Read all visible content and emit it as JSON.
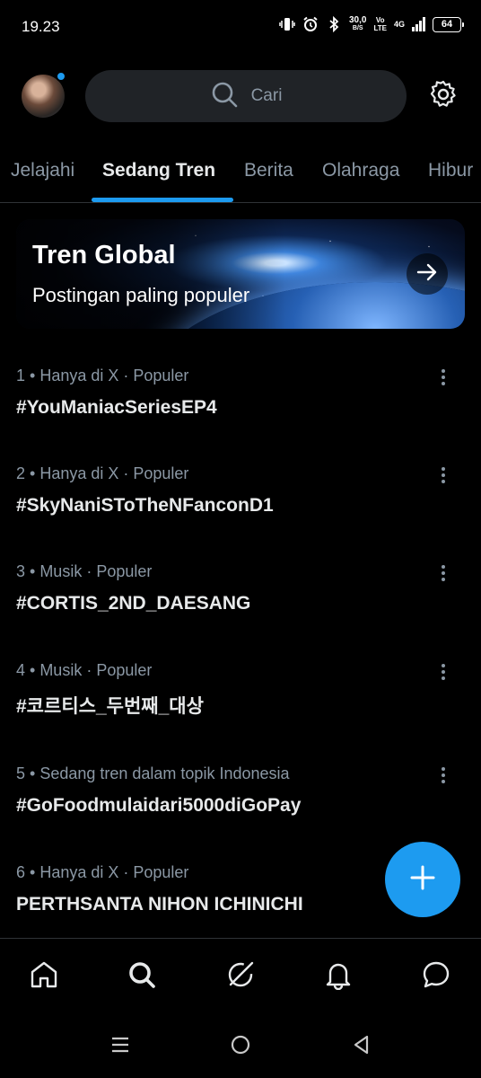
{
  "status_bar": {
    "time": "19.23",
    "speed_value": "30,0",
    "speed_unit": "B/S",
    "volte_top": "Vo",
    "volte_bottom": "LTE",
    "network": "4G",
    "battery": "64"
  },
  "header": {
    "search_placeholder": "Cari"
  },
  "tabs": [
    {
      "label": "Jelajahi",
      "active": false
    },
    {
      "label": "Sedang Tren",
      "active": true
    },
    {
      "label": "Berita",
      "active": false
    },
    {
      "label": "Olahraga",
      "active": false
    },
    {
      "label": "Hibur",
      "active": false
    }
  ],
  "banner": {
    "title": "Tren Global",
    "subtitle": "Postingan paling populer"
  },
  "trends": [
    {
      "meta": "1 • Hanya di X · Populer",
      "name": "#YouManiacSeriesEP4"
    },
    {
      "meta": "2 • Hanya di X · Populer",
      "name": "#SkyNaniSToTheNFanconD1"
    },
    {
      "meta": "3 • Musik · Populer",
      "name": "#CORTIS_2ND_DAESANG"
    },
    {
      "meta": "4 • Musik · Populer",
      "name": "#코르티스_두번째_대상"
    },
    {
      "meta": "5 • Sedang tren dalam topik Indonesia",
      "name": "#GoFoodmulaidari5000diGoPay"
    },
    {
      "meta": "6 • Hanya di X · Populer",
      "name": "PERTHSANTA NIHON ICHINICHI"
    }
  ],
  "bottom_nav": {
    "items": [
      "home-icon",
      "search-icon",
      "grok-icon",
      "notifications-icon",
      "messages-icon"
    ]
  },
  "colors": {
    "accent": "#1d9bf0",
    "background": "#000000",
    "secondary_text": "#8b98a5",
    "primary_text": "#e7e9ea"
  }
}
